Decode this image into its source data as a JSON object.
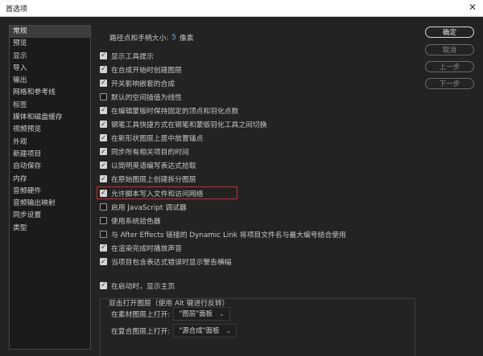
{
  "window": {
    "title": "首选项"
  },
  "sidebar": {
    "items": [
      {
        "label": "常规",
        "selected": true
      },
      {
        "label": "预览"
      },
      {
        "label": "显示"
      },
      {
        "label": "导入"
      },
      {
        "label": "输出"
      },
      {
        "label": "网格和参考线"
      },
      {
        "label": "标签"
      },
      {
        "label": "媒体和磁盘缓存"
      },
      {
        "label": "视频预览"
      },
      {
        "label": "外观"
      },
      {
        "label": "新建项目"
      },
      {
        "label": "自动保存"
      },
      {
        "label": "内存"
      },
      {
        "label": "音频硬件"
      },
      {
        "label": "音频输出映射"
      },
      {
        "label": "同步设置"
      },
      {
        "label": "类型"
      }
    ]
  },
  "general": {
    "path_point_label": "路径点和手柄大小:",
    "path_point_value": "5",
    "path_point_unit": "像素",
    "options": [
      {
        "label": "显示工具提示",
        "checked": true
      },
      {
        "label": "在合成开始时创建图层",
        "checked": true
      },
      {
        "label": "开关影响嵌套的合成",
        "checked": true
      },
      {
        "label": "默认的空间插值为线性",
        "checked": false
      },
      {
        "label": "在编辑蒙版时保持固定的顶点和羽化点数",
        "checked": true
      },
      {
        "label": "钢笔工具快捷方式在钢笔和蒙版羽化工具之间切换",
        "checked": true
      },
      {
        "label": "在新形状图层上居中放置锚点",
        "checked": true
      },
      {
        "label": "同步所有相关项目的时间",
        "checked": true
      },
      {
        "label": "以简明英语编写表达式拾取",
        "checked": true
      },
      {
        "label": "在原始图层上创建拆分图层",
        "checked": true
      },
      {
        "label": "允许脚本写入文件和访问网络",
        "checked": true,
        "highlighted": true
      },
      {
        "label": "启用 JavaScript 调试器",
        "checked": false
      },
      {
        "label": "使用系统拾色器",
        "checked": false
      },
      {
        "label": "与 After Effects 链接的 Dynamic Link 将项目文件名与最大编号结合使用",
        "checked": false
      },
      {
        "label": "在渲染完成时播放声音",
        "checked": true
      },
      {
        "label": "当项目包含表达式错误时显示警告横幅",
        "checked": true
      }
    ],
    "startup_option": {
      "label": "在启动时，显示主页",
      "checked": true
    },
    "open_group": {
      "title": "双击打开图层（使用 Alt 键进行反转）",
      "rows": [
        {
          "label": "在素材图层上打开:",
          "value": "\"图层\"面板"
        },
        {
          "label": "在复合图层上打开:",
          "value": "\"源合成\"面板"
        }
      ]
    }
  },
  "buttons": {
    "ok": "确定",
    "cancel": "取消",
    "prev": "上一步",
    "next": "下一步"
  },
  "icons": {
    "close": "close-icon",
    "checkmark": "checkmark-icon",
    "dropdown": "chevron-down-icon"
  },
  "colors": {
    "highlight_border": "#d2282e",
    "accent_value": "#6fa8ff"
  }
}
